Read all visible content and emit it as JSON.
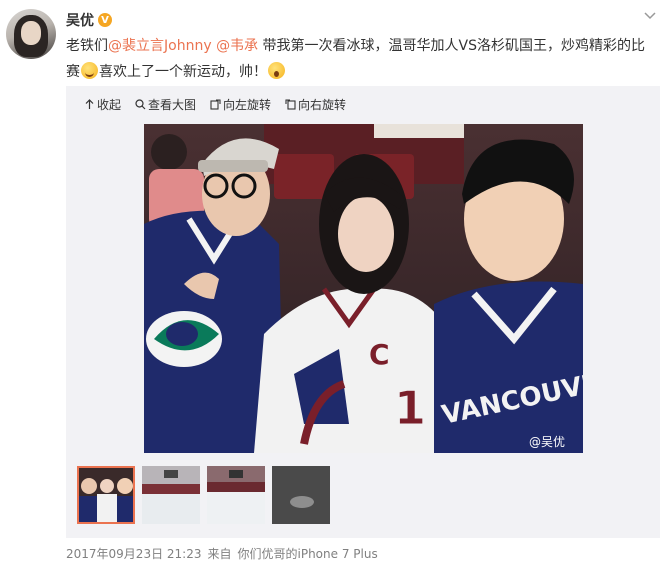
{
  "user": {
    "name": "吴优",
    "verified_badge": "V"
  },
  "post": {
    "t1": "老铁们",
    "m1": "@裴立言Johnny",
    "sp": " ",
    "m2": "@韦承",
    "t2": " 带我第一次看冰球，温哥华加人VS洛杉矶国王，炒鸡精彩的比赛",
    "t3": "喜欢上了一个新运动，帅！"
  },
  "toolbar": {
    "collapse": "收起",
    "view_large": "查看大图",
    "rotate_left": "向左旋转",
    "rotate_right": "向右旋转"
  },
  "photo": {
    "watermark": "@吴优",
    "jersey_text": "VANCOUVER",
    "captain_mark": "C",
    "jersey_number": "1"
  },
  "meta": {
    "timestamp": "2017年09月23日 21:23",
    "source_prefix": "来自",
    "device": "你们优哥的iPhone 7 Plus"
  },
  "colors": {
    "mention": "#eb7350",
    "badge": "#f5a623",
    "jersey_blue": "#1f2a6b",
    "jersey_green": "#0a7a5a"
  }
}
